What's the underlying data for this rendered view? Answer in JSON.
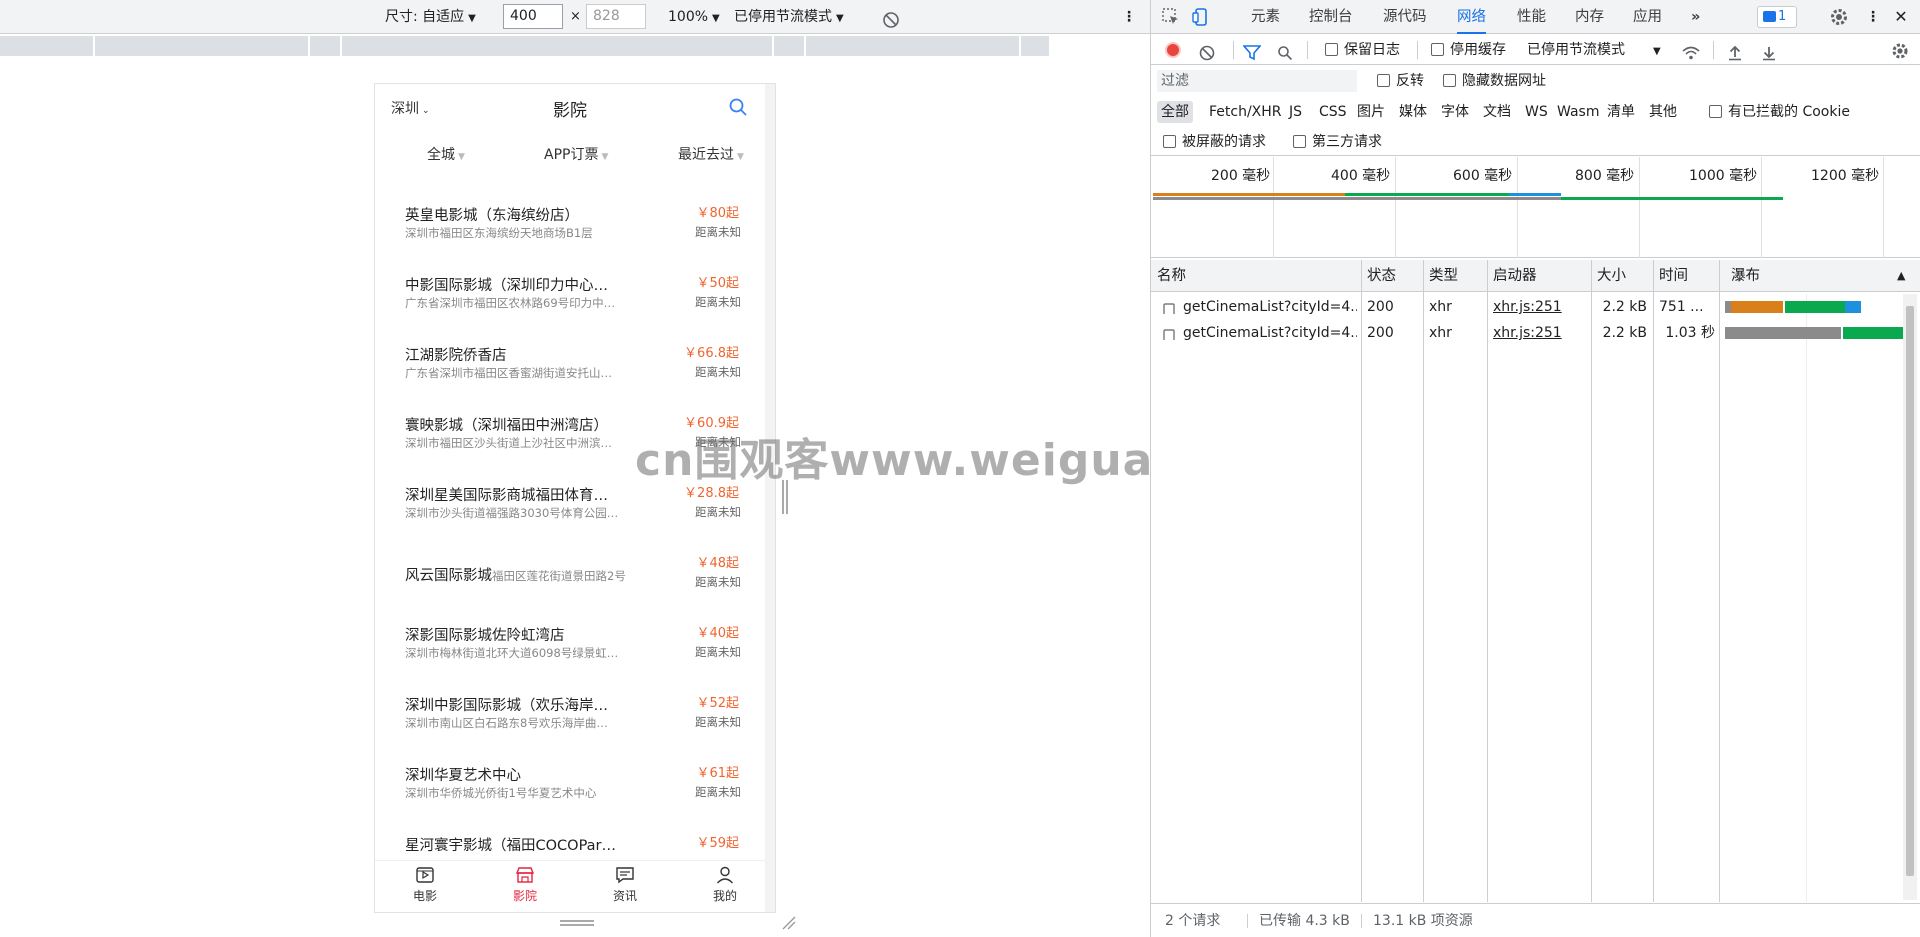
{
  "device_toolbar": {
    "size_label": "尺寸: 自适应",
    "width": "400",
    "height": "828",
    "zoom": "100%",
    "throttle": "已停用节流模式"
  },
  "mobile": {
    "city": "深圳",
    "title": "影院",
    "filters": [
      "全城",
      "APP订票",
      "最近去过"
    ],
    "cinemas": [
      {
        "name": "英皇电影城（东海缤纷店）",
        "addr": "深圳市福田区东海缤纷天地商场B1层",
        "price": "￥80起",
        "dist": "距离未知"
      },
      {
        "name": "中影国际影城（深圳印力中心…",
        "addr": "广东省深圳市福田区农林路69号印力中…",
        "price": "￥50起",
        "dist": "距离未知"
      },
      {
        "name": "江湖影院侨香店",
        "addr": "广东省深圳市福田区香蜜湖街道安托山…",
        "price": "￥66.8起",
        "dist": "距离未知"
      },
      {
        "name": "寰映影城（深圳福田中洲湾店）",
        "addr": "深圳市福田区沙头街道上沙社区中洲滨…",
        "price": "￥60.9起",
        "dist": "距离未知"
      },
      {
        "name": "深圳星美国际影商城福田体育…",
        "addr": "深圳市沙头街道福强路3030号体育公园…",
        "price": "￥28.8起",
        "dist": "距离未知"
      },
      {
        "name": "风云国际影城",
        "addr": "福田区莲花街道景田路2号",
        "price": "￥48起",
        "dist": "距离未知"
      },
      {
        "name": "深影国际影城佐阾虹湾店",
        "addr": "深圳市梅林街道北环大道6098号绿景虹…",
        "price": "￥40起",
        "dist": "距离未知"
      },
      {
        "name": "深圳中影国际影城（欢乐海岸…",
        "addr": "深圳市南山区白石路东8号欢乐海岸曲…",
        "price": "￥52起",
        "dist": "距离未知"
      },
      {
        "name": "深圳华夏艺术中心",
        "addr": "深圳市华侨城光侨街1号华夏艺术中心",
        "price": "￥61起",
        "dist": "距离未知"
      },
      {
        "name": "星河寰宇影城（福田COCOPar…",
        "addr": "",
        "price": "￥59起",
        "dist": ""
      }
    ],
    "tabs": [
      {
        "label": "电影",
        "icon": "movie-icon"
      },
      {
        "label": "影院",
        "icon": "cinema-icon"
      },
      {
        "label": "资讯",
        "icon": "news-icon"
      },
      {
        "label": "我的",
        "icon": "user-icon"
      }
    ],
    "accent": "#e5243d",
    "price_color": "#f0652f"
  },
  "watermark": "cn围观客www.weiguanke.cn",
  "devtools": {
    "tabs": [
      "元素",
      "控制台",
      "源代码",
      "网络",
      "性能",
      "内存",
      "应用"
    ],
    "active_tab": "网络",
    "issues_count": "1",
    "toolbar": {
      "preserve_log": "保留日志",
      "disable_cache": "停用缓存",
      "throttle": "已停用节流模式"
    },
    "filter": {
      "placeholder": "过滤",
      "invert": "反转",
      "hide_data_urls": "隐藏数据网址"
    },
    "types": [
      "全部",
      "Fetch/XHR",
      "JS",
      "CSS",
      "图片",
      "媒体",
      "字体",
      "文档",
      "WS",
      "Wasm",
      "清单",
      "其他"
    ],
    "blocked_cookies": "有已拦截的 Cookie",
    "blocked_requests": "被屏蔽的请求",
    "third_party": "第三方请求",
    "timeline_ticks": [
      "200 毫秒",
      "400 毫秒",
      "600 毫秒",
      "800 毫秒",
      "1000 毫秒",
      "1200 毫秒"
    ],
    "columns": [
      "名称",
      "状态",
      "类型",
      "启动器",
      "大小",
      "时间",
      "瀑布"
    ],
    "requests": [
      {
        "name": "getCinemaList?cityId=4...",
        "status": "200",
        "type": "xhr",
        "initiator": "xhr.js:251",
        "size": "2.2 kB",
        "time": "751 ..."
      },
      {
        "name": "getCinemaList?cityId=4...",
        "status": "200",
        "type": "xhr",
        "initiator": "xhr.js:251",
        "size": "2.2 kB",
        "time": "1.03 秒"
      }
    ],
    "status": {
      "requests": "2 个请求",
      "transferred": "已传输 4.3 kB",
      "resources": "13.1 kB 项资源"
    },
    "colors": {
      "active_blue": "#1a73e8",
      "waterfall_wait": "#d9801a",
      "waterfall_download": "#0aa84f",
      "waterfall_blue": "#1e90e0",
      "waterfall_gray": "#8b8b8b"
    }
  }
}
